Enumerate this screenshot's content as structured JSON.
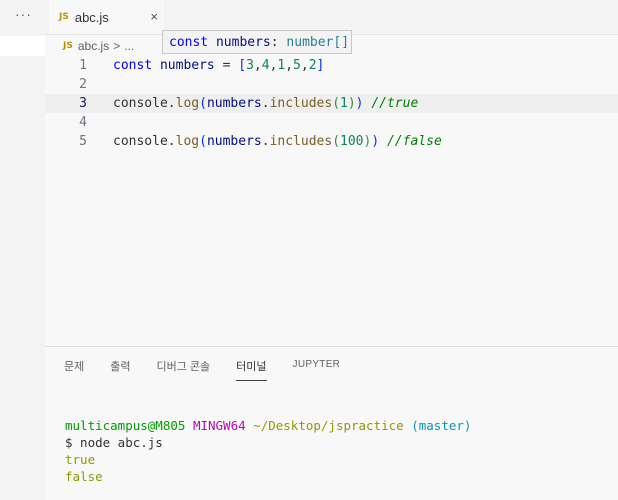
{
  "window": {
    "more_label": "···"
  },
  "tabbar": {
    "tab": {
      "badge": "JS",
      "title": "abc.js",
      "close": "×"
    }
  },
  "breadcrumb": {
    "badge": "JS",
    "file": "abc.js",
    "separator": ">",
    "more": "..."
  },
  "hover": {
    "keyword": "const",
    "name": "numbers",
    "colon": ":",
    "type": "number[]"
  },
  "editor": {
    "current_line": 3,
    "lines": [
      {
        "number": "1"
      },
      {
        "number": "2"
      },
      {
        "number": "3"
      },
      {
        "number": "4"
      },
      {
        "number": "5"
      }
    ],
    "line1": {
      "kw": "const",
      "var": "numbers",
      "op": " = ",
      "open": "[",
      "n1": "3",
      "c1": ",",
      "n2": "4",
      "c2": ",",
      "n3": "1",
      "c3": ",",
      "n4": "5",
      "c4": ",",
      "n5": "2",
      "close": "]"
    },
    "line3": {
      "obj": "console",
      "dot1": ".",
      "fn1": "log",
      "p1": "(",
      "var": "numbers",
      "dot2": ".",
      "fn2": "includes",
      "p2": "(",
      "num": "1",
      "p3": ")",
      "p4": ")",
      "comment": " //true"
    },
    "line5": {
      "obj": "console",
      "dot1": ".",
      "fn1": "log",
      "p1": "(",
      "var": "numbers",
      "dot2": ".",
      "fn2": "includes",
      "p2": "(",
      "num": "100",
      "p3": ")",
      "p4": ")",
      "comment": " //false"
    }
  },
  "panel": {
    "tabs": [
      {
        "label": "문제"
      },
      {
        "label": "출력"
      },
      {
        "label": "디버그 콘솔"
      },
      {
        "label": "터미널"
      },
      {
        "label": "JUPYTER"
      }
    ],
    "active_tab": "터미널"
  },
  "terminal": {
    "prompt": {
      "user": "multicampus@M805",
      "system": "MINGW64",
      "path": "~/Desktop/jspractice",
      "branch": "(master)"
    },
    "command": "$ node abc.js",
    "outputs": [
      "true",
      "false"
    ]
  },
  "colors": {
    "keyword": "#0000ff",
    "variable": "#001080",
    "number": "#098658",
    "function": "#795e26",
    "comment": "#008000",
    "js_badge": "#b89500"
  }
}
